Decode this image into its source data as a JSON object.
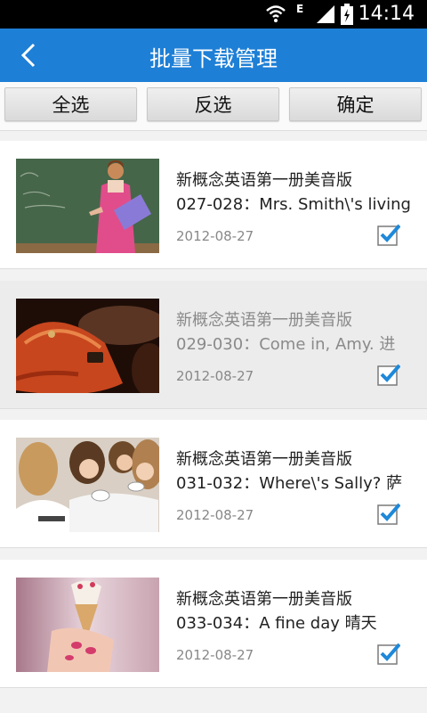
{
  "status_bar": {
    "time": "14:14",
    "network": "E"
  },
  "header": {
    "title": "批量下载管理",
    "back_icon": "chevron-left-icon"
  },
  "actions": {
    "select_all": "全选",
    "invert": "反选",
    "confirm": "确定"
  },
  "items": [
    {
      "title": "新概念英语第一册美音版",
      "subtitle": "027-028：Mrs. Smith\\'s living",
      "date": "2012-08-27",
      "checked": true,
      "selected": false,
      "thumb": "teacher-chalkboard"
    },
    {
      "title": "新概念英语第一册美音版",
      "subtitle": "029-030：Come in, Amy. 进",
      "date": "2012-08-27",
      "checked": true,
      "selected": true,
      "thumb": "orange-handbag"
    },
    {
      "title": "新概念英语第一册美音版",
      "subtitle": "031-032：Where\\'s Sally? 萨",
      "date": "2012-08-27",
      "checked": true,
      "selected": false,
      "thumb": "women-tea"
    },
    {
      "title": "新概念英语第一册美音版",
      "subtitle": "033-034：A fine day 晴天",
      "date": "2012-08-27",
      "checked": true,
      "selected": false,
      "thumb": "ice-cream"
    }
  ],
  "colors": {
    "accent": "#1e7fd6",
    "check": "#1e88d9"
  }
}
